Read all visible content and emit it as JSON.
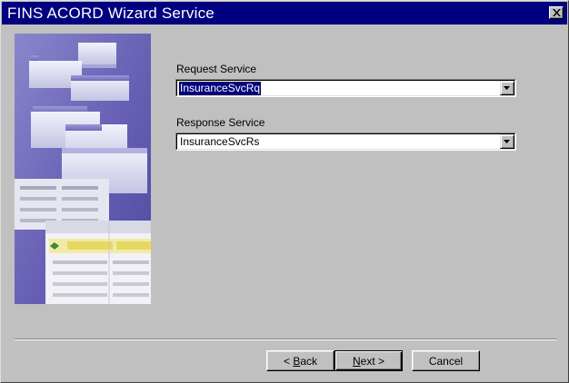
{
  "window": {
    "title": "FINS ACORD Wizard Service"
  },
  "form": {
    "request_label": "Request Service",
    "request_value": "InsuranceSvcRq",
    "response_label": "Response Service",
    "response_value": "InsuranceSvcRs"
  },
  "buttons": {
    "back": {
      "arrow": "< ",
      "mnemonic": "B",
      "rest": "ack"
    },
    "next": {
      "mnemonic": "N",
      "rest": "ext",
      "arrow": " >"
    },
    "cancel": "Cancel"
  },
  "icons": {
    "close": "close-icon",
    "dropdown": "chevron-down-icon"
  },
  "colors": {
    "titlebar": "#000080",
    "face": "#c0c0c0",
    "art_background": "#6a64b4"
  }
}
